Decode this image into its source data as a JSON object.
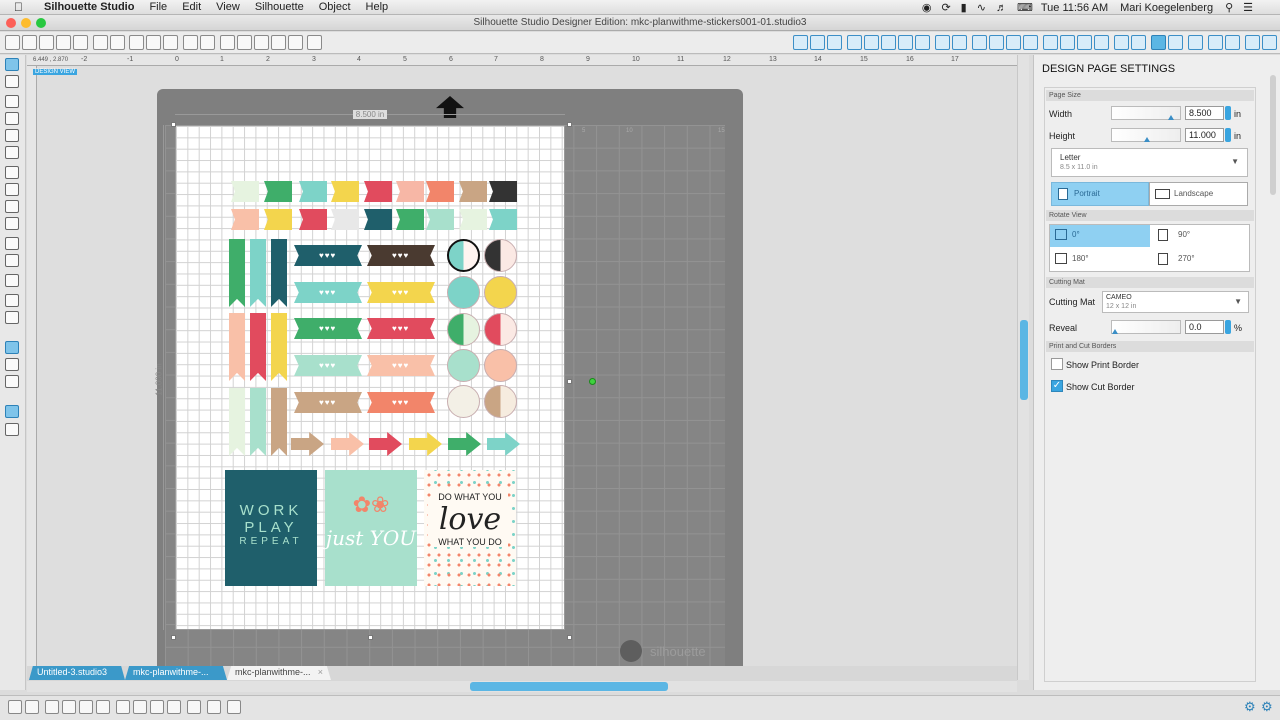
{
  "menubar": {
    "app": "Silhouette Studio",
    "items": [
      "File",
      "Edit",
      "View",
      "Silhouette",
      "Object",
      "Help"
    ],
    "clock": "Tue 11:56 AM",
    "user": "Mari Koegelenberg"
  },
  "window": {
    "title": "Silhouette Studio Designer Edition: mkc-planwithme-stickers001-01.studio3"
  },
  "canvas": {
    "design_view_label": "DESIGN VIEW",
    "coords": "6.449 , 2.870",
    "ruler_h_ticks": [
      "-2",
      "-1",
      "0",
      "1",
      "2",
      "3",
      "4",
      "5",
      "6",
      "7",
      "8",
      "9",
      "10",
      "11",
      "12",
      "13",
      "14",
      "15",
      "16",
      "17"
    ],
    "page_width_dim": "8.500 in",
    "page_height_dim": "11.000 in",
    "mat_ticks": [
      "5",
      "10",
      "15"
    ],
    "watermark": "silhouette",
    "cards": {
      "card1_lines": [
        "WORK",
        "PLAY",
        "REPEAT"
      ],
      "card2_text": "just YOU",
      "card3_top": "DO WHAT YOU",
      "card3_mid": "love",
      "card3_bot": "WHAT YOU DO"
    }
  },
  "tabs": [
    "Untitled-3.studio3",
    "mkc-planwithme-...",
    "mkc-planwithme-..."
  ],
  "panel": {
    "title": "DESIGN PAGE SETTINGS",
    "page_size_section": "Page Size",
    "width_label": "Width",
    "width_value": "8.500",
    "height_label": "Height",
    "height_value": "11.000",
    "unit": "in",
    "paper_name": "Letter",
    "paper_dims": "8.5 x 11.0 in",
    "orientation": {
      "portrait": "Portrait",
      "landscape": "Landscape",
      "selected": "Portrait"
    },
    "rotate_section": "Rotate View",
    "rotate": {
      "r0": "0°",
      "r90": "90°",
      "r180": "180°",
      "r270": "270°",
      "selected": "0°"
    },
    "mat_section": "Cutting Mat",
    "mat_label": "Cutting Mat",
    "mat_name": "CAMEO",
    "mat_size": "12 x 12 in",
    "reveal_label": "Reveal",
    "reveal_value": "0.0",
    "reveal_unit": "%",
    "borders_section": "Print and Cut Borders",
    "print_border": {
      "label": "Show Print Border",
      "checked": false
    },
    "cut_border": {
      "label": "Show Cut Border",
      "checked": true
    }
  },
  "colors": {
    "accent": "#3aa5e0",
    "teal_dark": "#1f5f6b",
    "mint": "#a8e0cc",
    "coral": "#f2856a",
    "pink": "#e14b5e",
    "green": "#3fae6a",
    "yellow": "#f3d54d",
    "tan": "#c9a584"
  }
}
